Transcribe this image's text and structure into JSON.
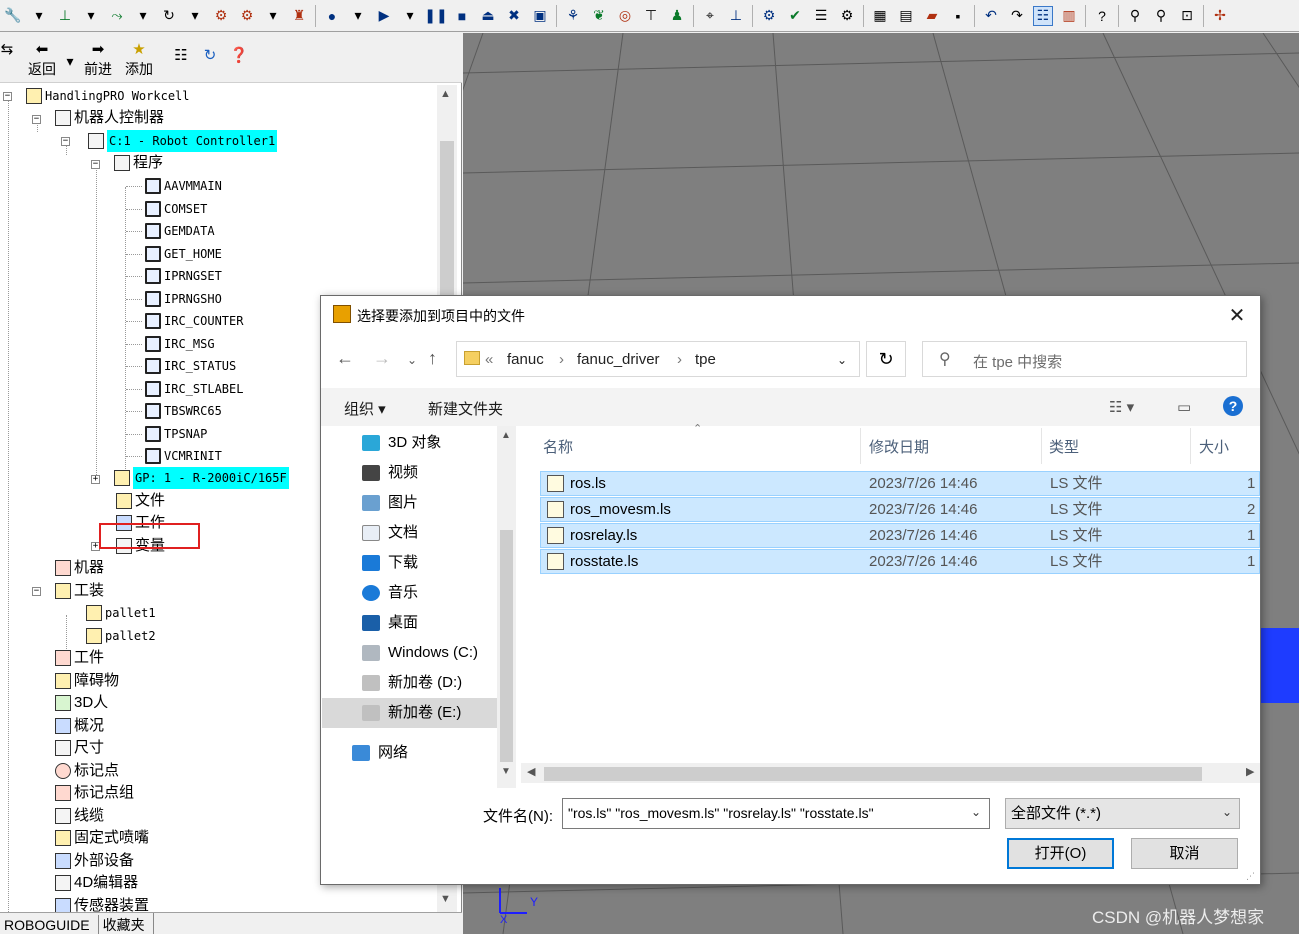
{
  "toolbar": {
    "icons": [
      "tool-icon",
      "frame-icon",
      "path-icon",
      "move-icon",
      "gear-icon",
      "robot-icon",
      "teach-icon",
      "2d-icon",
      "play-icon",
      "pause-icon",
      "stop-icon",
      "eject-icon",
      "reset-icon",
      "sim-icon",
      "network-icon",
      "marker-icon",
      "target-icon",
      "place-icon",
      "user-icon",
      "gripper-icon",
      "measure-icon",
      "check-icon",
      "online-icon",
      "setup-icon",
      "grid-icon",
      "document-icon",
      "open-folder-icon",
      "save-icon",
      "undo-icon",
      "redo-icon",
      "tree-icon",
      "chart-icon",
      "help-icon",
      "zoom-in-icon",
      "zoom-out-icon",
      "zoom-fit-icon",
      "axis-icon"
    ]
  },
  "nav": {
    "back": "返回",
    "forward": "前进",
    "add": "添加"
  },
  "tree": {
    "root": "HandlingPRO Workcell",
    "controllers": "机器人控制器",
    "controller": "C:1 - Robot Controller1",
    "programs": "程序",
    "program_items": [
      "AAVMMAIN",
      "COMSET",
      "GEMDATA",
      "GET_HOME",
      "IPRNGSET",
      "IPRNGSHO",
      "IRC_COUNTER",
      "IRC_MSG",
      "IRC_STATUS",
      "IRC_STLABEL",
      "TBSWRC65",
      "TPSNAP",
      "VCMRINIT"
    ],
    "gp": "GP: 1 - R-2000iC/165F",
    "files": "文件",
    "work": "工作",
    "variables": "变量",
    "machines": "机器",
    "fixtures": "工装",
    "fixture_items": [
      "pallet1",
      "pallet2"
    ],
    "parts": "工件",
    "obstacles": "障碍物",
    "human3d": "3D人",
    "overview": "概况",
    "dimension": "尺寸",
    "markers": "标记点",
    "marker_groups": "标记点组",
    "cables": "线缆",
    "fixed_nozzle": "固定式喷嘴",
    "external_devices": "外部设备",
    "editor4d": "4D编辑器",
    "sensors": "传感器装置"
  },
  "bottom_tabs": [
    "ROBOGUIDE",
    "收藏夹"
  ],
  "watermark": "CSDN @机器人梦想家",
  "axis_label": "Y",
  "axis_x": "X",
  "dialog": {
    "title": "选择要添加到项目中的文件",
    "breadcrumb": [
      "«",
      "fanuc",
      "›",
      "fanuc_driver",
      "›",
      "tpe"
    ],
    "search_placeholder": "在 tpe 中搜索",
    "organize": "组织 ▾",
    "new_folder": "新建文件夹",
    "nav_items": [
      "3D 对象",
      "视频",
      "图片",
      "文档",
      "下载",
      "音乐",
      "桌面",
      "Windows (C:)",
      "新加卷 (D:)",
      "新加卷 (E:)",
      "网络"
    ],
    "columns": [
      "名称",
      "修改日期",
      "类型",
      "大小"
    ],
    "files": [
      {
        "name": "ros.ls",
        "date": "2023/7/26 14:46",
        "type": "LS 文件",
        "size": "1"
      },
      {
        "name": "ros_movesm.ls",
        "date": "2023/7/26 14:46",
        "type": "LS 文件",
        "size": "2"
      },
      {
        "name": "rosrelay.ls",
        "date": "2023/7/26 14:46",
        "type": "LS 文件",
        "size": "1"
      },
      {
        "name": "rosstate.ls",
        "date": "2023/7/26 14:46",
        "type": "LS 文件",
        "size": "1"
      }
    ],
    "filename_label": "文件名(N):",
    "filename_value": "\"ros.ls\" \"ros_movesm.ls\" \"rosrelay.ls\" \"rosstate.ls\"",
    "filetype": "全部文件 (*.*)",
    "open": "打开(O)",
    "cancel": "取消"
  },
  "colors": {
    "highlight": "#00ffff",
    "selection": "#cce8ff",
    "accent": "#0078d7",
    "viewport": "#7f7f7f",
    "annotation": "#e02020"
  }
}
